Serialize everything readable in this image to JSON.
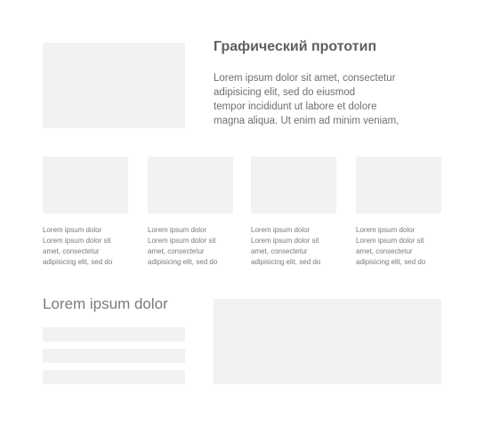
{
  "hero": {
    "title": "Графический прототип",
    "text_lines": [
      "Lorem ipsum dolor sit amet, consectetur",
      "adipisicing elit, sed do eiusmod",
      "tempor incididunt ut labore et dolore",
      "magna aliqua. Ut enim ad minim veniam,"
    ]
  },
  "cards": [
    {
      "lines": [
        "Lorem ipsum dolor",
        "Lorem ipsum dolor sit",
        "amet, consectetur",
        "adipisicing elit, sed do"
      ]
    },
    {
      "lines": [
        "Lorem ipsum dolor",
        "Lorem ipsum dolor sit",
        "amet, consectetur",
        "adipisicing elit, sed do"
      ]
    },
    {
      "lines": [
        "Lorem ipsum dolor",
        "Lorem ipsum dolor sit",
        "amet, consectetur",
        "adipisicing elit, sed do"
      ]
    },
    {
      "lines": [
        "Lorem ipsum dolor",
        "Lorem ipsum dolor sit",
        "amet, consectetur",
        "adipisicing elit, sed do"
      ]
    }
  ],
  "bottom": {
    "title": "Lorem ipsum dolor"
  },
  "colors": {
    "placeholder": "#f2f2f2",
    "text": "#6f6f6f"
  }
}
